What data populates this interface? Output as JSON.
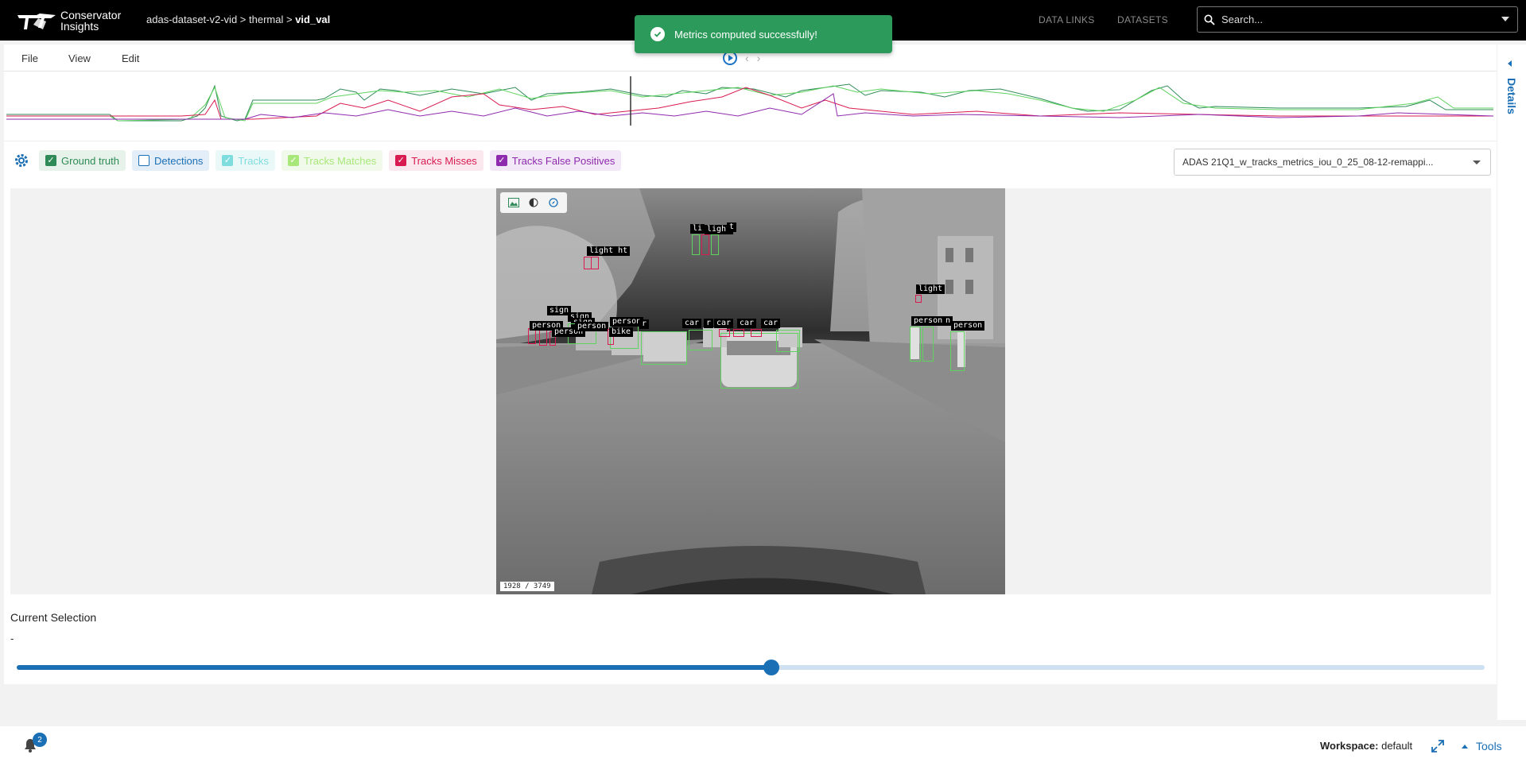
{
  "app": {
    "name_line1": "Conservator",
    "name_line2": "Insights"
  },
  "breadcrumb": {
    "dataset": "adas-dataset-v2-vid",
    "sep1": " > ",
    "folder": "thermal",
    "sep2": " > ",
    "current": "vid_val"
  },
  "nav": {
    "data_links": "DATA LINKS",
    "datasets": "DATASETS"
  },
  "search": {
    "placeholder": "Search..."
  },
  "toast": {
    "message": "Metrics computed successfully!",
    "color": "#2c9a5a"
  },
  "menu": {
    "file": "File",
    "view": "View",
    "edit": "Edit"
  },
  "filters": [
    {
      "label": "Ground truth",
      "checked": true,
      "color": "#2e8b57",
      "bg": "#e7f3ea"
    },
    {
      "label": "Detections",
      "checked": false,
      "color": "#1a6fb5",
      "bg": "#e4eef8"
    },
    {
      "label": "Tracks",
      "checked": true,
      "color": "#7fdde0",
      "bg": "#eaf8f8"
    },
    {
      "label": "Tracks Matches",
      "checked": true,
      "color": "#a8e87a",
      "bg": "#f1f9ea"
    },
    {
      "label": "Tracks Misses",
      "checked": true,
      "color": "#d81b50",
      "bg": "#fbe7ee"
    },
    {
      "label": "Tracks False Positives",
      "checked": true,
      "color": "#8e2aad",
      "bg": "#f3e8f7"
    }
  ],
  "model_select": {
    "value": "ADAS 21Q1_w_tracks_metrics_iou_0_25_08-12-remappi..."
  },
  "frame": {
    "counter": "1928 / 3749",
    "labels": {
      "light_ht": "light ht",
      "li": "li",
      "light_top": "light",
      "light_top_b": "t",
      "light_right": "light",
      "sign1": "sign",
      "sign2": "sign",
      "sign3": "sign",
      "person1": "person",
      "person2": "person",
      "person3": "person",
      "person4": "person",
      "r1": "r",
      "bike": "bike",
      "car1": "car",
      "r2": "r",
      "car2": "car",
      "car3": "car",
      "car4": "car",
      "person5": "person",
      "n": "n",
      "person6": "person"
    }
  },
  "selection": {
    "title": "Current Selection",
    "value": "-",
    "progress": 0.5143
  },
  "details": {
    "label": "Details"
  },
  "bottom": {
    "notifications": "2",
    "workspace_label": "Workspace:",
    "workspace_value": "default",
    "tools": "Tools"
  }
}
